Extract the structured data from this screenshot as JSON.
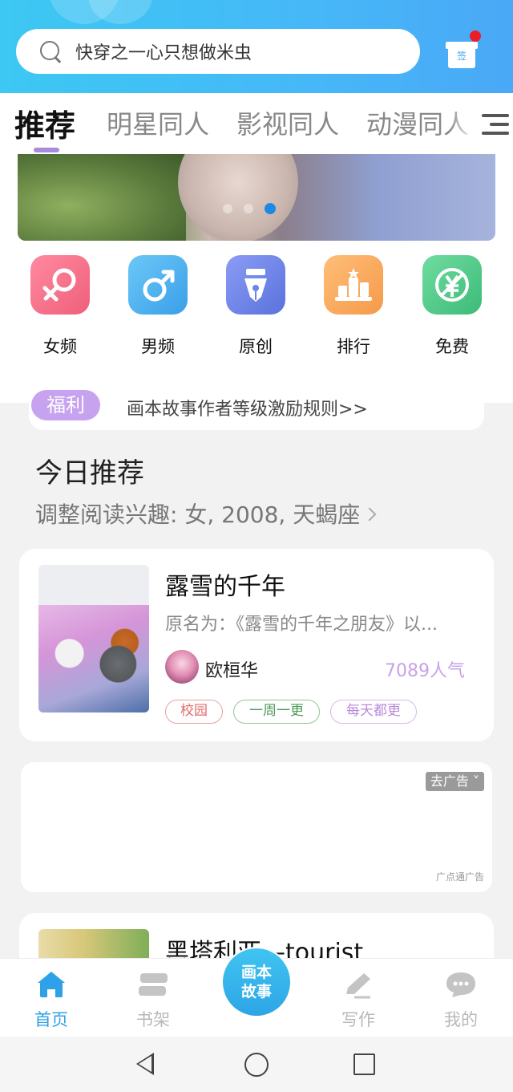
{
  "search": {
    "placeholder_text": "快穿之一心只想做米虫"
  },
  "checkin": {
    "label": "签"
  },
  "tabs": [
    {
      "label": "推荐",
      "active": true
    },
    {
      "label": "明星同人",
      "active": false
    },
    {
      "label": "影视同人",
      "active": false
    },
    {
      "label": "动漫同人",
      "active": false
    }
  ],
  "banner": {
    "slide_count": 3,
    "active_index": 2
  },
  "categories": [
    {
      "label": "女频",
      "icon": "female-icon",
      "color": "#f27187"
    },
    {
      "label": "男频",
      "icon": "male-icon",
      "color": "#4fb4f0"
    },
    {
      "label": "原创",
      "icon": "pen-nib-icon",
      "color": "#6d84e8"
    },
    {
      "label": "排行",
      "icon": "podium-icon",
      "color": "#f7a75e"
    },
    {
      "label": "免费",
      "icon": "yen-free-icon",
      "color": "#52c989"
    }
  ],
  "notice": {
    "badge": "福利",
    "text": "画本故事作者等级激励规则>>"
  },
  "today": {
    "title": "今日推荐",
    "subtitle": "调整阅读兴趣: 女, 2008, 天蝎座"
  },
  "book1": {
    "title": "露雪的千年",
    "desc": "原名为：《露雪的千年之朋友》以...",
    "author": "欧桓华",
    "popularity": "7089人气",
    "tags": [
      {
        "label": "校园",
        "color": "#e06a6a"
      },
      {
        "label": "一周一更",
        "color": "#4a9a5a"
      },
      {
        "label": "每天都更",
        "color": "#b88ad8"
      }
    ]
  },
  "ad": {
    "button": "去广告",
    "source": "广点通广告"
  },
  "book2": {
    "title": "黑塔利亚—tourist"
  },
  "tabbar": {
    "items": [
      {
        "label": "首页",
        "active": true
      },
      {
        "label": "书架",
        "active": false
      },
      {
        "label": "写作",
        "active": false
      },
      {
        "label": "我的",
        "active": false
      }
    ],
    "center_line1": "画本",
    "center_line2": "故事"
  },
  "colors": {
    "accent": "#2ea1e8",
    "header_blue": "#46b8f8",
    "purple": "#a78bdf"
  }
}
